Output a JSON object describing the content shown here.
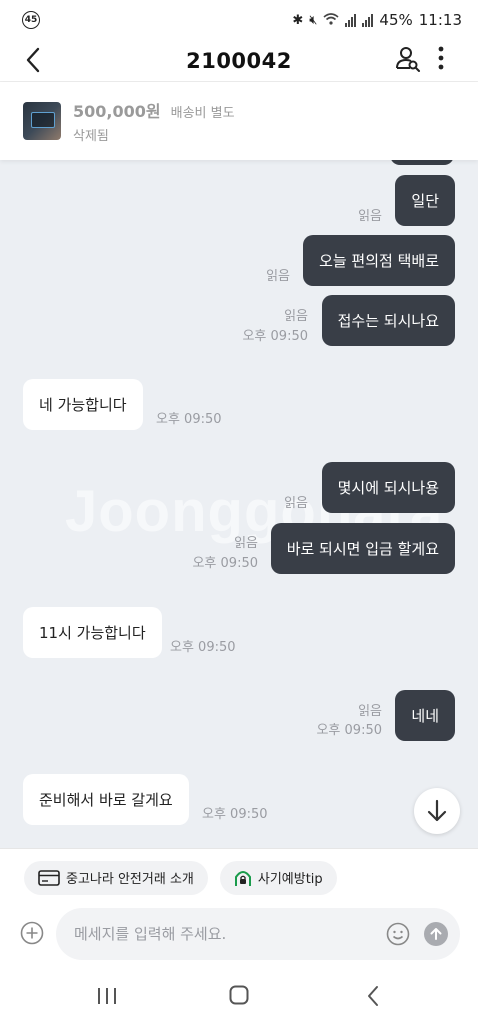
{
  "status_bar": {
    "notification_badge": "45",
    "battery": "45%",
    "time": "11:13"
  },
  "header": {
    "title": "2100042"
  },
  "product": {
    "price": "500,000원",
    "shipping": "배송비 별도",
    "status": "삭제됨"
  },
  "chat": {
    "watermark": "Joonggonara",
    "messages": [
      {
        "id": 0,
        "direction": "out",
        "text": "일단",
        "read": "읽음",
        "time": ""
      },
      {
        "id": 1,
        "direction": "out",
        "text": "오늘 편의점 택배로",
        "read": "읽음",
        "time": ""
      },
      {
        "id": 2,
        "direction": "out",
        "text": "접수는 되시나요",
        "read": "읽음",
        "time": "오후 09:50"
      },
      {
        "id": 3,
        "direction": "in",
        "text": "네 가능합니다",
        "read": "",
        "time": "오후 09:50"
      },
      {
        "id": 4,
        "direction": "out",
        "text": "몇시에 되시나용",
        "read": "읽음",
        "time": ""
      },
      {
        "id": 5,
        "direction": "out",
        "text": "바로 되시면 입금 할게요",
        "read": "읽음",
        "time": "오후 09:50"
      },
      {
        "id": 6,
        "direction": "in",
        "text": "11시 가능합니다",
        "read": "",
        "time": "오후 09:50"
      },
      {
        "id": 7,
        "direction": "out",
        "text": "네네",
        "read": "읽음",
        "time": "오후 09:50"
      },
      {
        "id": 8,
        "direction": "in",
        "text": "준비해서 바로 갈게요",
        "read": "",
        "time": "오후 09:50"
      }
    ]
  },
  "chips": {
    "safe_trade": "중고나라 안전거래 소개",
    "fraud_tip": "사기예방tip"
  },
  "input": {
    "placeholder": "메세지를 입력해 주세요."
  },
  "colors": {
    "outgoing_bubble": "#393e47",
    "incoming_bubble": "#ffffff",
    "chat_background": "#eceff3",
    "accent_green": "#1a9b4b"
  }
}
